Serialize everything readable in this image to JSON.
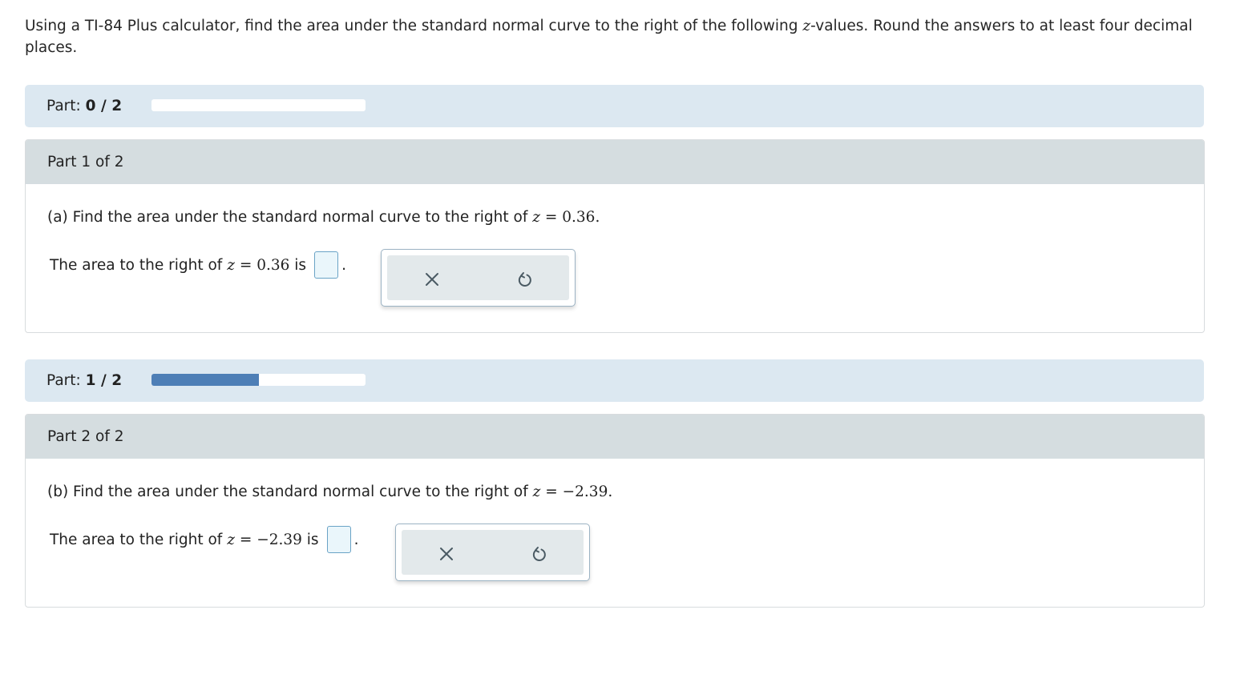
{
  "instructions": {
    "prefix": "Using a TI-84 Plus calculator, find the area under the standard normal curve to the right of the following ",
    "var": "z",
    "suffix": "-values. Round the answers to at least four decimal places."
  },
  "progress": [
    {
      "label": "Part:",
      "current": "0",
      "sep": "/",
      "total": "2",
      "fraction": 0.0
    },
    {
      "label": "Part:",
      "current": "1",
      "sep": "/",
      "total": "2",
      "fraction": 0.5
    }
  ],
  "parts": [
    {
      "header": "Part 1 of 2",
      "question_prefix": "(a) Find the area under the standard normal curve to the right of ",
      "var": "z",
      "equals": " = ",
      "value": "0.36",
      "question_end": ".",
      "answer_prefix": "The area to the right of ",
      "answer_value": "0.36",
      "answer_is": " is",
      "answer_end": "."
    },
    {
      "header": "Part 2 of 2",
      "question_prefix": "(b) Find the area under the standard normal curve to the right of ",
      "var": "z",
      "equals": " = ",
      "value": "−2.39",
      "question_end": ".",
      "answer_prefix": "The area to the right of ",
      "answer_value": "−2.39",
      "answer_is": " is",
      "answer_end": "."
    }
  ],
  "tools": {
    "clear_icon": "close-icon",
    "undo_icon": "undo-icon"
  },
  "colors": {
    "progress_fill": "#4d7eb6",
    "progress_bg": "#dce8f1",
    "header_bg": "#d5dde0",
    "answer_box": "#eaf6fb"
  }
}
